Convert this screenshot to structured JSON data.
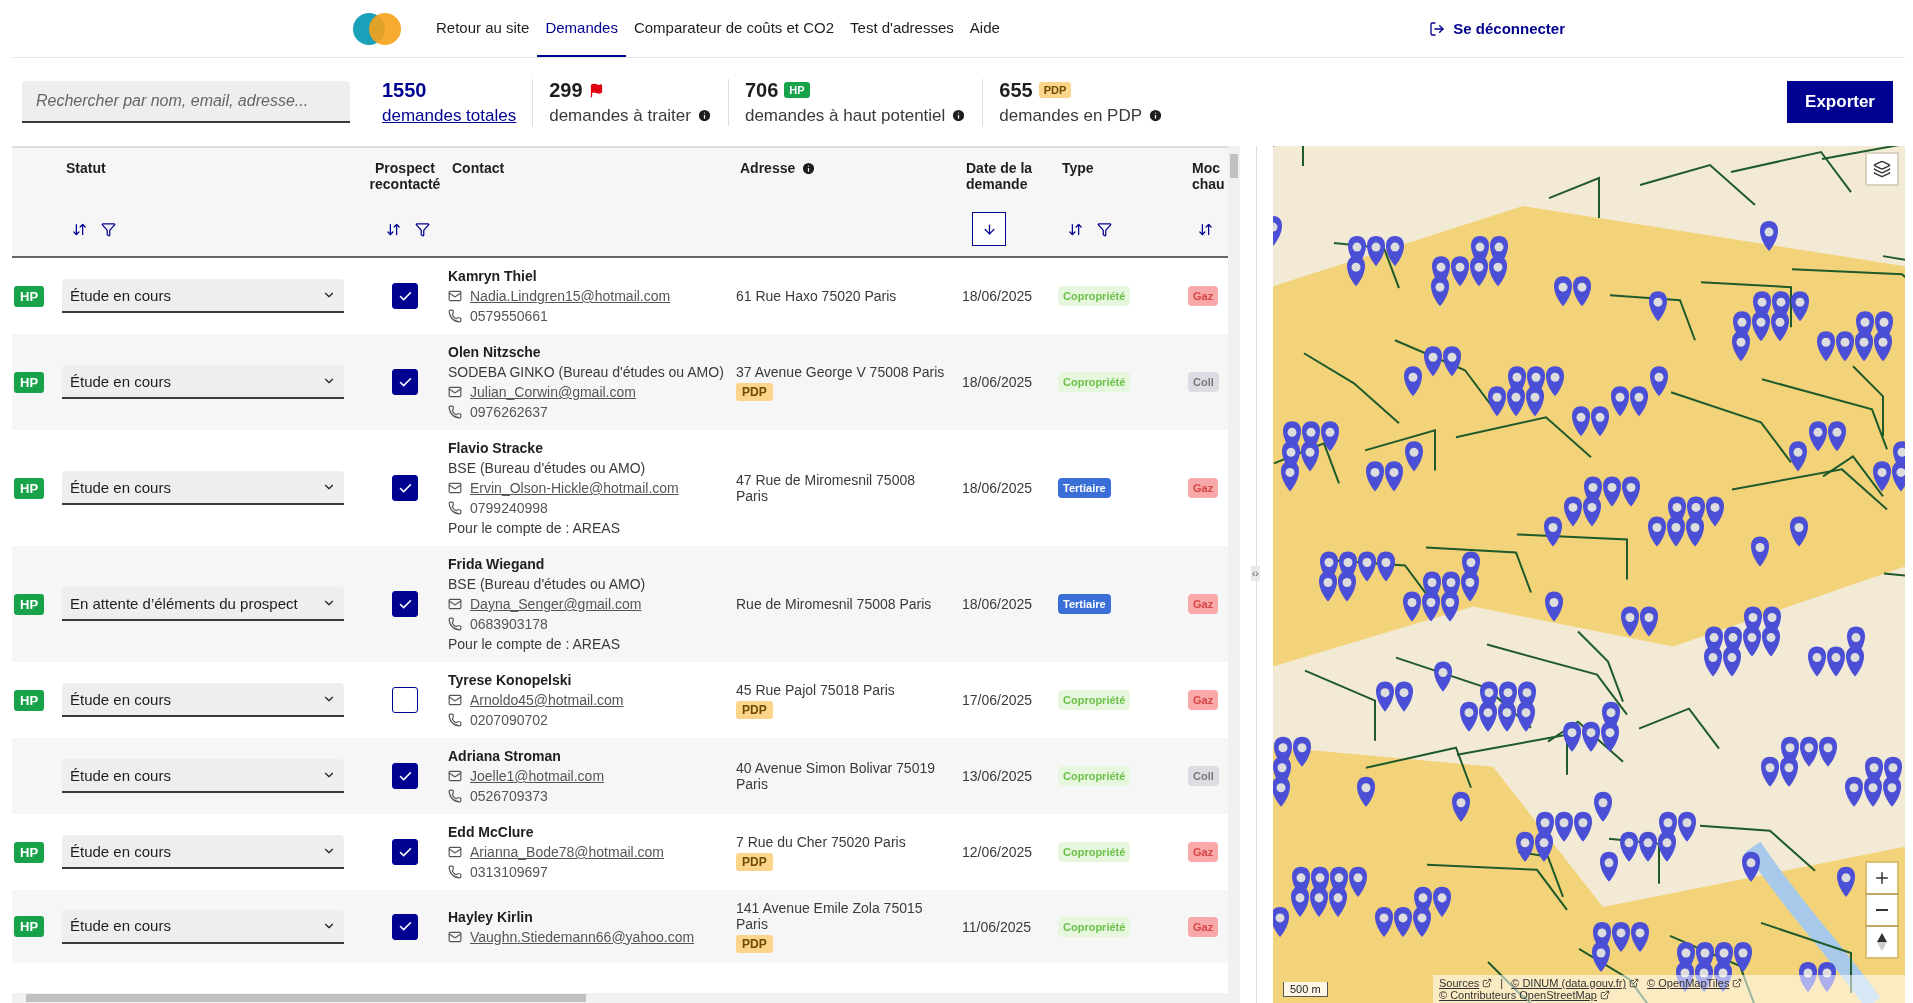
{
  "nav": {
    "links": [
      {
        "label": "Retour au site",
        "selected": false
      },
      {
        "label": "Demandes",
        "selected": true
      },
      {
        "label": "Comparateur de coûts et CO2",
        "selected": false
      },
      {
        "label": "Test d'adresses",
        "selected": false
      },
      {
        "label": "Aide",
        "selected": false
      }
    ],
    "logout": "Se déconnecter"
  },
  "search": {
    "placeholder": "Rechercher par nom, email, adresse..."
  },
  "stats": [
    {
      "kind": "total",
      "value": "1550",
      "label": "demandes totales"
    },
    {
      "kind": "flag",
      "value": "299",
      "label": "demandes à traiter"
    },
    {
      "kind": "badge",
      "value": "706",
      "badge": "HP",
      "label": "demandes à haut potentiel"
    },
    {
      "kind": "badge_pdp",
      "value": "655",
      "badge": "PDP",
      "label": "demandes en PDP"
    }
  ],
  "export_button": "Exporter",
  "table": {
    "columns": [
      {
        "kind": "sort_filter",
        "label": "Statut"
      },
      {
        "kind": "sort_filter_center",
        "label": "Prospect recontacté"
      },
      {
        "kind": "plain",
        "label": "Contact"
      },
      {
        "kind": "info",
        "label": "Adresse"
      },
      {
        "kind": "sorted",
        "label": "Date de la demande"
      },
      {
        "kind": "sort_filter",
        "label": "Type"
      },
      {
        "kind": "sort",
        "label": "Moc chau"
      }
    ],
    "rows": [
      {
        "badge": "HP",
        "status": "Étude en cours",
        "contacted": true,
        "name": "Kamryn Thiel",
        "email": "Nadia.Lindgren15@hotmail.com",
        "phone": "0579550661",
        "address": "61 Rue Haxo 75020 Paris",
        "date": "18/06/2025",
        "type": {
          "label": "Copropriété",
          "kind": "copro"
        },
        "mode": {
          "label": "Gaz",
          "kind": "gaz"
        }
      },
      {
        "badge": "HP",
        "status": "Étude en cours",
        "contacted": true,
        "name": "Olen Nitzsche",
        "company": "SODEBA GINKO (Bureau d'études ou AMO)",
        "email": "Julian_Corwin@gmail.com",
        "phone": "0976262637",
        "address": "37 Avenue George V 75008 Paris",
        "pdp": "PDP",
        "date": "18/06/2025",
        "type": {
          "label": "Copropriété",
          "kind": "copro"
        },
        "mode": {
          "label": "Coll",
          "kind": "coll"
        }
      },
      {
        "badge": "HP",
        "status": "Étude en cours",
        "contacted": true,
        "name": "Flavio Stracke",
        "company": "BSE (Bureau d'études ou AMO)",
        "email": "Ervin_Olson-Hickle@hotmail.com",
        "phone": "0799240998",
        "account": "Pour le compte de : AREAS",
        "address": "47 Rue de Miromesnil 75008 Paris",
        "date": "18/06/2025",
        "type": {
          "label": "Tertiaire",
          "kind": "tertiaire"
        },
        "mode": {
          "label": "Gaz",
          "kind": "gaz"
        }
      },
      {
        "badge": "HP",
        "status": "En attente d’éléments du prospect",
        "contacted": true,
        "name": "Frida Wiegand",
        "company": "BSE (Bureau d'études ou AMO)",
        "email": "Dayna_Senger@gmail.com",
        "phone": "0683903178",
        "account": "Pour le compte de : AREAS",
        "address": "Rue de Miromesnil 75008 Paris",
        "date": "18/06/2025",
        "type": {
          "label": "Tertiaire",
          "kind": "tertiaire"
        },
        "mode": {
          "label": "Gaz",
          "kind": "gaz"
        }
      },
      {
        "badge": "HP",
        "status": "Étude en cours",
        "contacted": false,
        "name": "Tyrese Konopelski",
        "email": "Arnoldo45@hotmail.com",
        "phone": "0207090702",
        "address": "45 Rue Pajol 75018 Paris",
        "pdp": "PDP",
        "date": "17/06/2025",
        "type": {
          "label": "Copropriété",
          "kind": "copro"
        },
        "mode": {
          "label": "Gaz",
          "kind": "gaz"
        }
      },
      {
        "status": "Étude en cours",
        "contacted": true,
        "name": "Adriana Stroman",
        "email": "Joelle1@hotmail.com",
        "phone": "0526709373",
        "address": "40 Avenue Simon Bolivar 75019 Paris",
        "date": "13/06/2025",
        "type": {
          "label": "Copropriété",
          "kind": "copro"
        },
        "mode": {
          "label": "Coll",
          "kind": "coll"
        }
      },
      {
        "badge": "HP",
        "status": "Étude en cours",
        "contacted": true,
        "name": "Edd McClure",
        "email": "Arianna_Bode78@hotmail.com",
        "phone": "0313109697",
        "address": "7 Rue du Cher 75020 Paris",
        "pdp": "PDP",
        "date": "12/06/2025",
        "type": {
          "label": "Copropriété",
          "kind": "copro"
        },
        "mode": {
          "label": "Gaz",
          "kind": "gaz"
        }
      },
      {
        "badge": "HP",
        "status": "Étude en cours",
        "contacted": true,
        "name": "Hayley Kirlin",
        "email": "Vaughn.Stiedemann66@yahoo.com",
        "address": "141 Avenue Emile Zola 75015 Paris",
        "pdp": "PDP",
        "date": "11/06/2025",
        "type": {
          "label": "Copropriété",
          "kind": "copro"
        },
        "mode": {
          "label": "Gaz",
          "kind": "gaz"
        }
      }
    ]
  },
  "splitter_handle": "‹›",
  "map": {
    "scale": "500 m",
    "attribution": [
      {
        "label": "Sources",
        "kind": "link"
      },
      {
        "label": "|",
        "kind": "separator"
      },
      {
        "label": "© DINUM (data.gouv.fr)",
        "kind": "link"
      },
      {
        "label": "© OpenMapTiles",
        "kind": "link"
      },
      {
        "label": "© Contributeurs OpenStreetMap",
        "kind": "link"
      }
    ]
  }
}
